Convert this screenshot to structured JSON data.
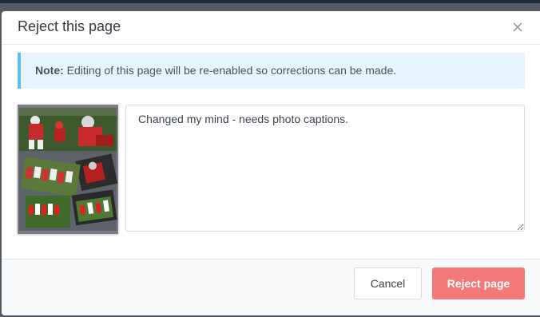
{
  "dialog": {
    "title": "Reject this page",
    "close_icon": "close-icon"
  },
  "note": {
    "label": "Note:",
    "text": " Editing of this page will be re-enabled so corrections can be made."
  },
  "thumbnail": {
    "icon": "page-thumbnail-image"
  },
  "comment": {
    "value": "Changed my mind - needs photo captions."
  },
  "footer": {
    "cancel_label": "Cancel",
    "reject_label": "Reject page"
  },
  "colors": {
    "accent_reject": "#f2787a",
    "note_border": "#5bc0eb",
    "note_background": "#e8f4fc"
  }
}
